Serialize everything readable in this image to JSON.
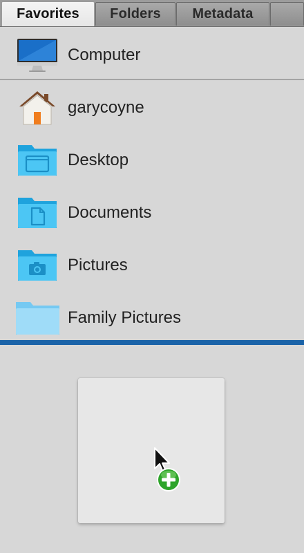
{
  "tabs": [
    {
      "label": "Favorites",
      "active": true
    },
    {
      "label": "Folders",
      "active": false
    },
    {
      "label": "Metadata",
      "active": false
    }
  ],
  "favorites": {
    "computer": {
      "label": "Computer",
      "icon": "imac-computer-icon"
    },
    "items": [
      {
        "label": "garycoyne",
        "icon": "home-folder-icon"
      },
      {
        "label": "Desktop",
        "icon": "desktop-folder-icon"
      },
      {
        "label": "Documents",
        "icon": "documents-folder-icon"
      },
      {
        "label": "Pictures",
        "icon": "pictures-folder-icon"
      },
      {
        "label": "Family Pictures",
        "icon": "generic-folder-icon"
      }
    ]
  },
  "drag": {
    "cursor_icon": "copy-cursor-icon",
    "badge_icon": "green-plus-icon"
  },
  "colors": {
    "folder_blue": "#37b8ee",
    "drop_indicator": "#1a63a8",
    "panel_background": "#d7d7d7",
    "plus_badge": "#2ea42a"
  }
}
